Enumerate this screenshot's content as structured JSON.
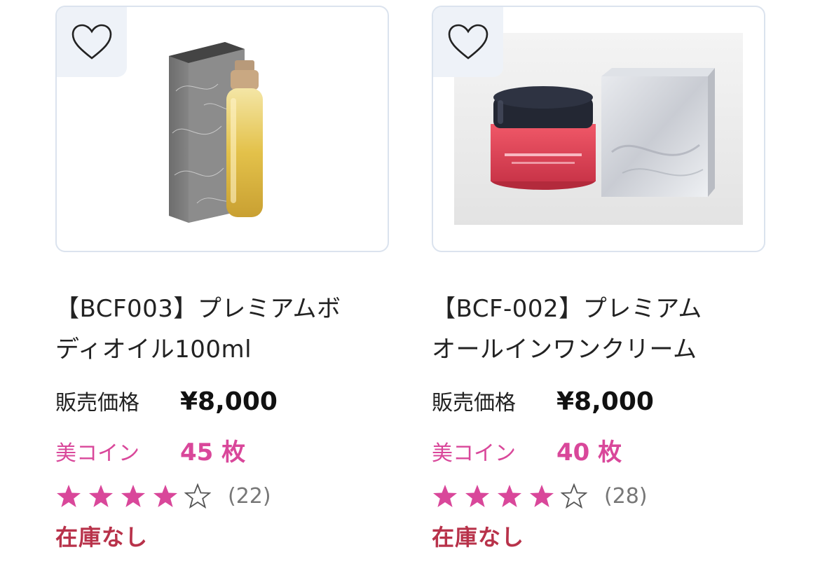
{
  "products": [
    {
      "title": "【BCF003】プレミアムボディオイル100ml",
      "title_line1": "【BCF003】プレミアムボ",
      "title_line2": "ディオイル100ml",
      "price_label": "販売価格",
      "price": "¥8,000",
      "coin_label": "美コイン",
      "coins": "45 枚",
      "rating": 4,
      "rating_max": 5,
      "review_count": "(22)",
      "stock_status": "在庫なし",
      "image_icon": "body-oil-bottle-with-box"
    },
    {
      "title": "【BCF-002】プレミアムオールインワンクリーム",
      "title_line1": "【BCF-002】プレミアム",
      "title_line2": "オールインワンクリーム",
      "price_label": "販売価格",
      "price": "¥8,000",
      "coin_label": "美コイン",
      "coins": "40 枚",
      "rating": 4,
      "rating_max": 5,
      "review_count": "(28)",
      "stock_status": "在庫なし",
      "image_icon": "cream-jar-with-box"
    }
  ],
  "colors": {
    "accent_pink": "#d9479a",
    "stock_red": "#b8324a",
    "card_border": "#dbe3ee",
    "fav_bg": "#eef2f8"
  }
}
